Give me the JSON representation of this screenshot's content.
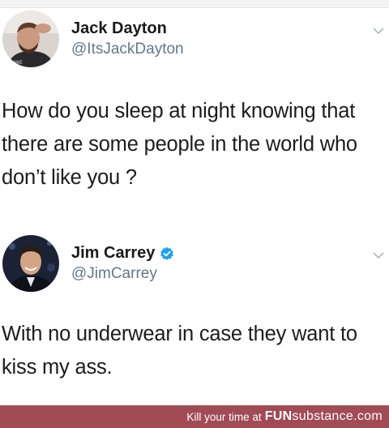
{
  "tweets": [
    {
      "name": "Jack Dayton",
      "handle": "@ItsJackDayton",
      "verified": false,
      "text": "How do you sleep at night knowing that there are some people in the world who don’t like you ?"
    },
    {
      "name": "Jim Carrey",
      "handle": "@JimCarrey",
      "verified": true,
      "text": "With no underwear in case they want to kiss my ass."
    }
  ],
  "footer": {
    "caption": "Kill your time at",
    "site_bold": "FUN",
    "site_rest": "substance.com"
  },
  "icons": {
    "chevron": "chevron-down-icon",
    "verified": "verified-badge-icon"
  },
  "colors": {
    "footer_bg": "#a14b55",
    "verified": "#1da1f2",
    "handle": "#657786"
  }
}
